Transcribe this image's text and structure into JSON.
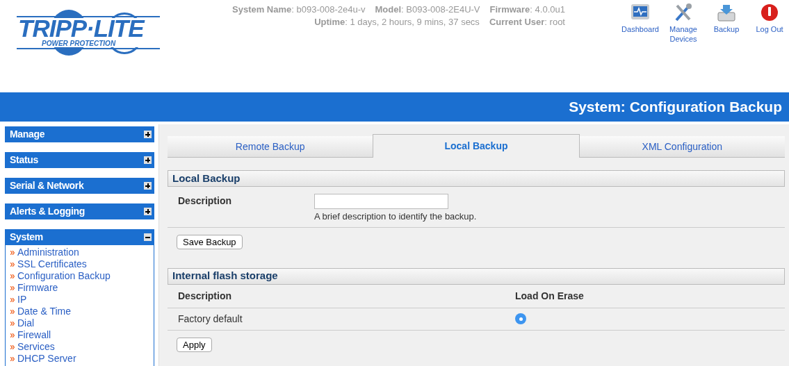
{
  "logo": {
    "brand": "TRIPP·LITE",
    "tagline": "POWER PROTECTION"
  },
  "system_info": [
    [
      "**System Name**: b093-008-2e4u-v",
      "**Model**: B093-008-2E4U-V",
      "**Firmware**: 4.0.0u1"
    ],
    [
      "**Uptime**: 1 days, 2 hours, 9 mins, 37 secs",
      "**Current User**: root"
    ]
  ],
  "toolbar": [
    {
      "kind": "dashboard",
      "label": "Dashboard"
    },
    {
      "kind": "tools",
      "label": "Manage Devices"
    },
    {
      "kind": "backup",
      "label": "Backup"
    },
    {
      "kind": "logout",
      "label": "Log Out"
    }
  ],
  "page_title": "System: Configuration Backup",
  "sidebar": [
    {
      "label": "Manage",
      "expanded": false
    },
    {
      "label": "Status",
      "expanded": false
    },
    {
      "label": "Serial & Network",
      "expanded": false
    },
    {
      "label": "Alerts & Logging",
      "expanded": false
    },
    {
      "label": "System",
      "expanded": true,
      "items": [
        "Administration",
        "SSL Certificates",
        "Configuration Backup",
        "Firmware",
        "IP",
        "Date & Time",
        "Dial",
        "Firewall",
        "Services",
        "DHCP Server"
      ]
    }
  ],
  "tabs": [
    {
      "label": "Remote Backup",
      "selected": false
    },
    {
      "label": "Local Backup",
      "selected": true
    },
    {
      "label": "XML Configuration",
      "selected": false
    }
  ],
  "local_backup": {
    "title": "Local Backup",
    "field_label": "Description",
    "hint": "A brief description to identify the backup.",
    "button": "Save Backup"
  },
  "flash_storage": {
    "title": "Internal flash storage",
    "columns": [
      "Description",
      "Load On Erase"
    ],
    "rows": [
      {
        "description": "Factory default",
        "selected": true
      }
    ],
    "button": "Apply"
  }
}
